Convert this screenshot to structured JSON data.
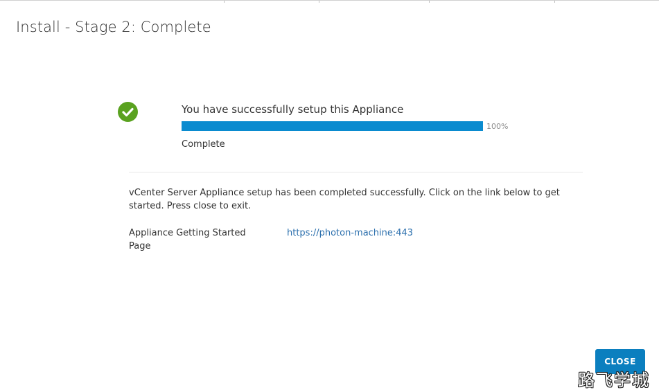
{
  "window": {
    "title": "Install - Stage 2: Complete"
  },
  "status": {
    "icon": "check-circle-icon",
    "headline": "You have successfully setup this Appliance",
    "progress_value": 100,
    "progress_label": "100%",
    "status_text": "Complete",
    "success_color": "#5aa220",
    "progress_color": "#0a8bcf"
  },
  "details": {
    "message": "vCenter Server Appliance setup has been completed successfully. Click on the link below to get started. Press close to exit.",
    "link_label": "Appliance Getting Started Page",
    "link_text": "https://photon-machine:443"
  },
  "footer": {
    "close_label": "CLOSE",
    "button_color": "#0b7fbf"
  },
  "watermark": {
    "text": "路飞学城"
  }
}
